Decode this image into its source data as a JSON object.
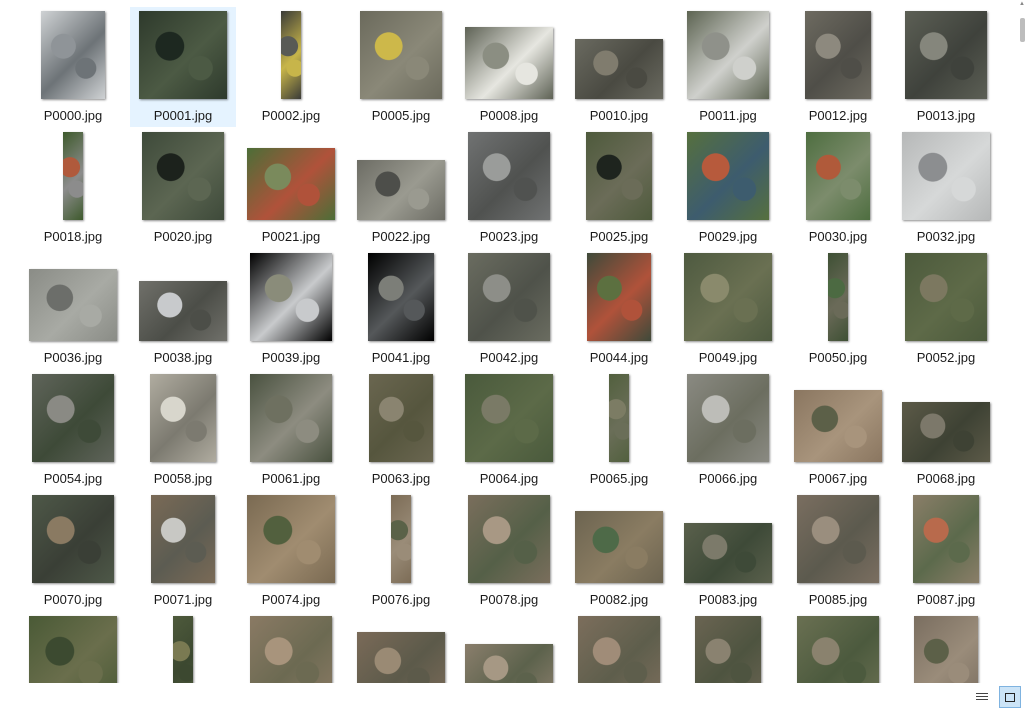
{
  "files": [
    {
      "name": "P0000.jpg",
      "colors": [
        "#cfd2d4",
        "#8f9498",
        "#6d7377"
      ],
      "selected": false
    },
    {
      "name": "P0001.jpg",
      "colors": [
        "#2e3a2c",
        "#1d2820",
        "#4c5a44"
      ],
      "selected": true
    },
    {
      "name": "P0002.jpg",
      "colors": [
        "#3a3b38",
        "#585a55",
        "#c7b54a"
      ],
      "selected": false
    },
    {
      "name": "P0005.jpg",
      "colors": [
        "#6b6a5c",
        "#cdb84a",
        "#8a8878"
      ],
      "selected": false
    },
    {
      "name": "P0008.jpg",
      "colors": [
        "#5e6255",
        "#8b8e82",
        "#e6e6e0"
      ],
      "selected": false
    },
    {
      "name": "P0010.jpg",
      "colors": [
        "#6a6a60",
        "#807c6e",
        "#4a4a42"
      ],
      "selected": false
    },
    {
      "name": "P0011.jpg",
      "colors": [
        "#5d6452",
        "#8f918a",
        "#cfd0cc"
      ],
      "selected": false
    },
    {
      "name": "P0012.jpg",
      "colors": [
        "#6d6a60",
        "#8d897e",
        "#4f4e48"
      ],
      "selected": false
    },
    {
      "name": "P0013.jpg",
      "colors": [
        "#5c5f55",
        "#85867c",
        "#3f423c"
      ],
      "selected": false
    },
    {
      "name": "P0018.jpg",
      "colors": [
        "#3e5a2c",
        "#b05a3c",
        "#8c8c8c"
      ],
      "selected": false
    },
    {
      "name": "P0020.jpg",
      "colors": [
        "#3e4a3a",
        "#1c221c",
        "#5c6652"
      ],
      "selected": false
    },
    {
      "name": "P0021.jpg",
      "colors": [
        "#4c6e38",
        "#7a8a5c",
        "#b0523a"
      ],
      "selected": false
    },
    {
      "name": "P0022.jpg",
      "colors": [
        "#6c6c64",
        "#4d4e4a",
        "#9a9a90"
      ],
      "selected": false
    },
    {
      "name": "P0023.jpg",
      "colors": [
        "#707272",
        "#9a9c9a",
        "#505250"
      ],
      "selected": false
    },
    {
      "name": "P0025.jpg",
      "colors": [
        "#4e5a3c",
        "#1e241e",
        "#6b6c58"
      ],
      "selected": false
    },
    {
      "name": "P0029.jpg",
      "colors": [
        "#56703e",
        "#b75a3c",
        "#3d5c6e"
      ],
      "selected": false
    },
    {
      "name": "P0030.jpg",
      "colors": [
        "#4e6e40",
        "#b05a3a",
        "#7c8c6c"
      ],
      "selected": false
    },
    {
      "name": "P0032.jpg",
      "colors": [
        "#b6b8b8",
        "#8c8e90",
        "#d6d8d8"
      ],
      "selected": false
    },
    {
      "name": "P0036.jpg",
      "colors": [
        "#8a8c86",
        "#6c6e6a",
        "#a8aaa4"
      ],
      "selected": false
    },
    {
      "name": "P0038.jpg",
      "colors": [
        "#70706a",
        "#c8cacc",
        "#4c4e48"
      ],
      "selected": false
    },
    {
      "name": "P0039.jpg",
      "colors": [
        "#000000",
        "#8a8c7a",
        "#c8cacc"
      ],
      "selected": false
    },
    {
      "name": "P0041.jpg",
      "colors": [
        "#000000",
        "#7c7e78",
        "#55585a"
      ],
      "selected": false
    },
    {
      "name": "P0042.jpg",
      "colors": [
        "#6a6c60",
        "#8d8e88",
        "#4f524a"
      ],
      "selected": false
    },
    {
      "name": "P0044.jpg",
      "colors": [
        "#3f4a3a",
        "#5c7040",
        "#b0523a"
      ],
      "selected": false
    },
    {
      "name": "P0049.jpg",
      "colors": [
        "#4e5a40",
        "#8a8a6c",
        "#6a7052"
      ],
      "selected": false
    },
    {
      "name": "P0050.jpg",
      "colors": [
        "#3e5034",
        "#4c6a42",
        "#6a6a58"
      ],
      "selected": false
    },
    {
      "name": "P0052.jpg",
      "colors": [
        "#4c5a3c",
        "#7c7860",
        "#5e6a48"
      ],
      "selected": false
    },
    {
      "name": "P0054.jpg",
      "colors": [
        "#5f645a",
        "#8a8a84",
        "#3e4a38"
      ],
      "selected": false
    },
    {
      "name": "P0058.jpg",
      "colors": [
        "#b0aca0",
        "#d8d6cc",
        "#7c7a70"
      ],
      "selected": false
    },
    {
      "name": "P0061.jpg",
      "colors": [
        "#4a5240",
        "#6e7060",
        "#8d8c80"
      ],
      "selected": false
    },
    {
      "name": "P0063.jpg",
      "colors": [
        "#6a6650",
        "#8a8470",
        "#56563e"
      ],
      "selected": false
    },
    {
      "name": "P0064.jpg",
      "colors": [
        "#4a5a3c",
        "#7a7a66",
        "#5c6a48"
      ],
      "selected": false
    },
    {
      "name": "P0065.jpg",
      "colors": [
        "#52603e",
        "#7c7c64",
        "#6a6e58"
      ],
      "selected": false
    },
    {
      "name": "P0066.jpg",
      "colors": [
        "#8a8a82",
        "#bdbdb8",
        "#6c6e60"
      ],
      "selected": false
    },
    {
      "name": "P0067.jpg",
      "colors": [
        "#8a7660",
        "#5c6048",
        "#a8947c"
      ],
      "selected": false
    },
    {
      "name": "P0068.jpg",
      "colors": [
        "#5c5a48",
        "#7c786a",
        "#3e4234"
      ],
      "selected": false
    },
    {
      "name": "P0070.jpg",
      "colors": [
        "#4e5848",
        "#8a7a62",
        "#3a3f36"
      ],
      "selected": false
    },
    {
      "name": "P0071.jpg",
      "colors": [
        "#7a6a56",
        "#c8c8c4",
        "#5c5c52"
      ],
      "selected": false
    },
    {
      "name": "P0074.jpg",
      "colors": [
        "#7a6a52",
        "#52603e",
        "#a08c70"
      ],
      "selected": false
    },
    {
      "name": "P0076.jpg",
      "colors": [
        "#7c6c56",
        "#5a6248",
        "#9a8c78"
      ],
      "selected": false
    },
    {
      "name": "P0078.jpg",
      "colors": [
        "#7a6e5c",
        "#a89884",
        "#556048"
      ],
      "selected": false
    },
    {
      "name": "P0082.jpg",
      "colors": [
        "#6c6450",
        "#4e6a48",
        "#8a7c62"
      ],
      "selected": false
    },
    {
      "name": "P0083.jpg",
      "colors": [
        "#5a604c",
        "#7c7a6a",
        "#3e4a38"
      ],
      "selected": false
    },
    {
      "name": "P0085.jpg",
      "colors": [
        "#7a6e60",
        "#9a8e7e",
        "#5c5a4e"
      ],
      "selected": false
    },
    {
      "name": "P0087.jpg",
      "colors": [
        "#8a7e68",
        "#b86a4c",
        "#5c6a4c"
      ],
      "selected": false
    },
    {
      "name": "",
      "colors": [
        "#4a5a36",
        "#3c4a30",
        "#6a6e4c"
      ],
      "selected": false
    },
    {
      "name": "",
      "colors": [
        "#4e5a3c",
        "#7a7a52",
        "#3c4830"
      ],
      "selected": false
    },
    {
      "name": "",
      "colors": [
        "#8a7a64",
        "#a8947c",
        "#6c6a52"
      ],
      "selected": false
    },
    {
      "name": "",
      "colors": [
        "#7a6a58",
        "#9a8a74",
        "#5c5a4a"
      ],
      "selected": false
    },
    {
      "name": "",
      "colors": [
        "#8a7e6c",
        "#a69884",
        "#5c624c"
      ],
      "selected": false
    },
    {
      "name": "",
      "colors": [
        "#7c6e5c",
        "#a08c78",
        "#5e5e4c"
      ],
      "selected": false
    },
    {
      "name": "",
      "colors": [
        "#6a6452",
        "#8a8270",
        "#4e5440"
      ],
      "selected": false
    },
    {
      "name": "",
      "colors": [
        "#6a7052",
        "#8a826e",
        "#4c5a3e"
      ],
      "selected": false
    },
    {
      "name": "",
      "colors": [
        "#7a6e60",
        "#5c6048",
        "#9a8c7a"
      ],
      "selected": false
    }
  ],
  "status": {
    "details_icon": "details-view-icon",
    "large_icon": "large-icons-view-icon"
  }
}
